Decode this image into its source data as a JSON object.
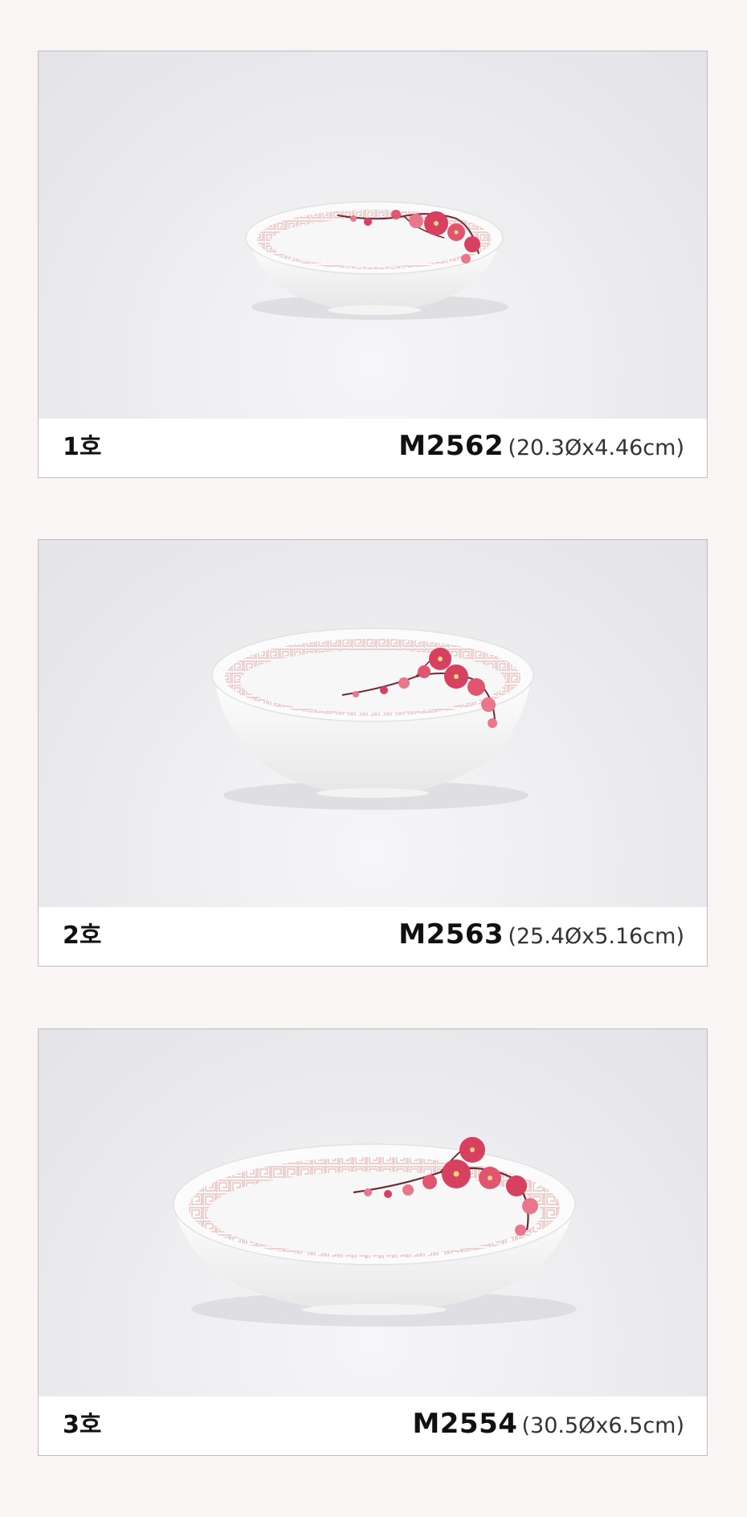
{
  "products": [
    {
      "size_label": "1호",
      "code": "M2562",
      "dimensions": "(20.3Øx4.46cm)"
    },
    {
      "size_label": "2호",
      "code": "M2563",
      "dimensions": "(25.4Øx5.16cm)"
    },
    {
      "size_label": "3호",
      "code": "M2554",
      "dimensions": "(30.5Øx6.5cm)"
    }
  ],
  "colors": {
    "page_background": "#faf5f5",
    "blossom": "#d8405f",
    "blossom_light": "#e8778d",
    "rim_pattern": "#e9c3c0"
  }
}
